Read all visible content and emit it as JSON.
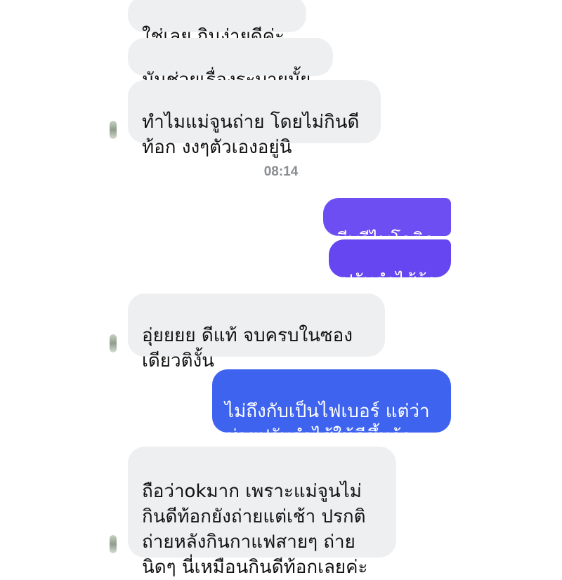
{
  "conversation": {
    "incoming": [
      {
        "text": "ใช่เลย กินง่ายดีค่ะ"
      },
      {
        "text": "มันช่วยเรื่องระบายมั้ย"
      },
      {
        "text": "ทำไมแม่จูนถ่าย โดยไม่กินดี\nท้อก งงๆตัวเองอยู่นิ"
      },
      {
        "text": "อุ่ยยยย ดีแท้ จบครบในซอง\nเดียวติงั้น"
      },
      {
        "text": "ถือว่าokมาก เพราะแม่จูนไม่\nกินดีท้อกยังถ่ายแต่เช้า ปรกติ\nถ่ายหลังกินกาแฟสายๆ ถ่าย\nนิดๆ นี่เหมือนกินดีท้อกเลยค่ะ"
      }
    ],
    "timestamp": "08:14",
    "outgoing": [
      {
        "text": "มีพรีไพโอติก"
      },
      {
        "text": "ปรับลำไส้จ้า"
      },
      {
        "text": "ไม่ถึงกับเป็นไฟเบอร์ แต่ว่า\nช่วยปรับลำไส้ให้ดีขึ้นจ้า"
      }
    ]
  },
  "colors": {
    "incoming_bubble": "#eeeff1",
    "outgoing_purple": "#6d4ef2",
    "outgoing_blue": "#3d63ef",
    "timestamp": "#8a8d91"
  }
}
